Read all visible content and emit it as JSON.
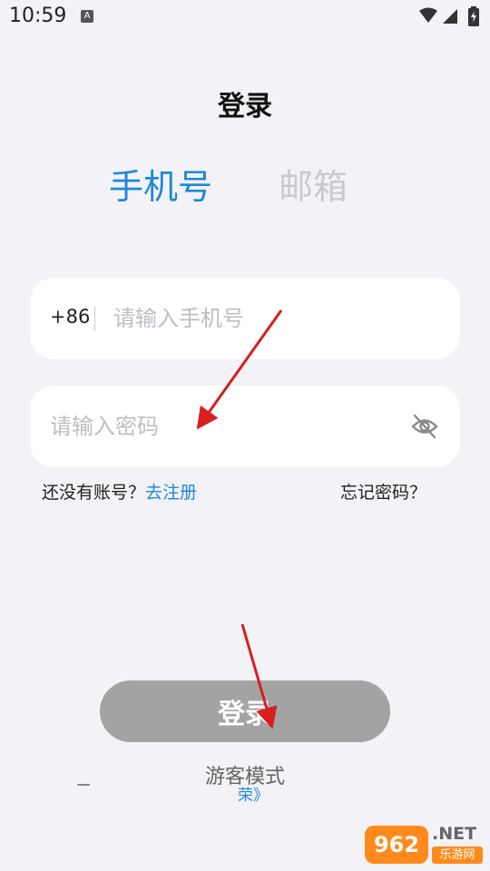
{
  "status_bar": {
    "time": "10:59",
    "badge": "A",
    "icons": [
      "wifi-icon",
      "signal-icon",
      "battery-icon"
    ]
  },
  "page": {
    "title": "登录"
  },
  "tabs": [
    {
      "label": "手机号",
      "active": true
    },
    {
      "label": "邮箱",
      "active": false
    }
  ],
  "phone_input": {
    "country_code": "+86",
    "placeholder": "请输入手机号",
    "value": ""
  },
  "password_input": {
    "placeholder": "请输入密码",
    "value": "",
    "toggle_icon": "eye-off-icon"
  },
  "links": {
    "no_account": "还没有账号？",
    "register": "去注册",
    "forgot": "忘记密码？"
  },
  "login_button": {
    "label": "登录"
  },
  "guest": {
    "label": "游客模式",
    "arrow_text": "荣》"
  },
  "watermark": {
    "logo": "962",
    "net": ".NET",
    "sub": "乐游网"
  },
  "colors": {
    "accent": "#1e88d9",
    "inactive_tab": "#c9c9cf",
    "button_disabled": "#a3a3a3",
    "background": "#f2f2f7",
    "annotation": "#d81e1e"
  }
}
